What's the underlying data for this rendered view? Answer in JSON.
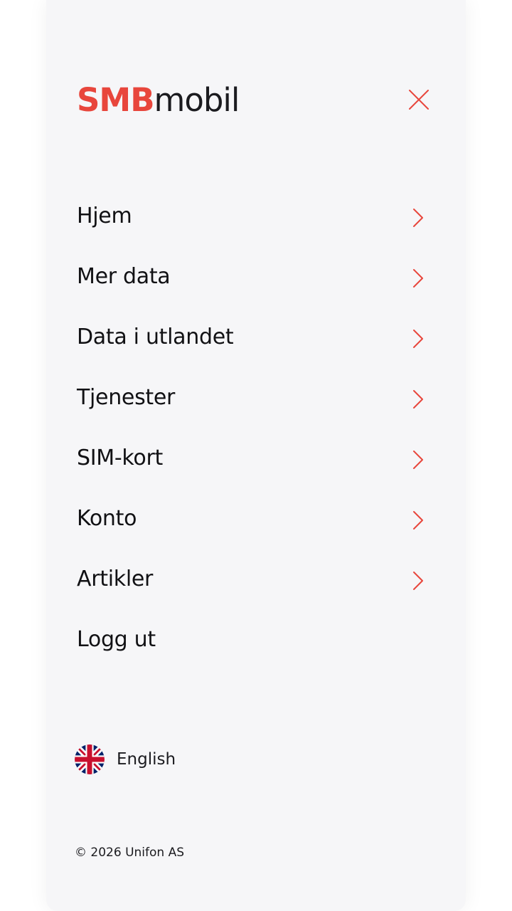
{
  "header": {
    "logo_brand": "SMB",
    "logo_suffix": "mobil",
    "close_icon": "close-icon"
  },
  "menu": {
    "items": [
      {
        "label": "Hjem",
        "icon": "chevron-right-icon"
      },
      {
        "label": "Mer data",
        "icon": "chevron-right-icon"
      },
      {
        "label": "Data i utlandet",
        "icon": "chevron-right-icon"
      },
      {
        "label": "Tjenester",
        "icon": "chevron-right-icon"
      },
      {
        "label": "SIM-kort",
        "icon": "chevron-right-icon"
      },
      {
        "label": "Konto",
        "icon": "chevron-right-icon"
      },
      {
        "label": "Artikler",
        "icon": "chevron-right-icon"
      },
      {
        "label": "Logg ut"
      }
    ]
  },
  "language": {
    "label": "English",
    "icon": "uk-flag-icon"
  },
  "footer": {
    "copyright": "© 2026 Unifon AS"
  },
  "colors": {
    "accent": "#e8463c",
    "text": "#111114",
    "panel_background": "#f6f6f8"
  }
}
